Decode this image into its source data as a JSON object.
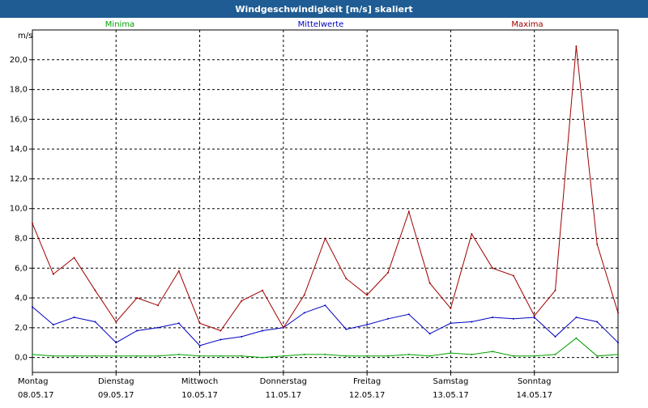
{
  "window": {
    "title": "Windgeschwindigkeit [m/s] skaliert"
  },
  "chart_data": {
    "type": "line",
    "title": "Windgeschwindigkeit [m/s] skaliert",
    "ylabel": "m/s",
    "xlabel": "",
    "ylim": [
      -1.0,
      22.0
    ],
    "xlim": [
      0,
      7
    ],
    "grid": true,
    "yticks": [
      0,
      2,
      4,
      6,
      8,
      10,
      12,
      14,
      16,
      18,
      20
    ],
    "ytick_labels": [
      "0,0",
      "2,0",
      "4,0",
      "6,0",
      "8,0",
      "10,0",
      "12,0",
      "14,0",
      "16,0",
      "18,0",
      "20,0"
    ],
    "x_ticks": [
      {
        "day": "Montag",
        "date": "08.05.17"
      },
      {
        "day": "Dienstag",
        "date": "09.05.17"
      },
      {
        "day": "Mittwoch",
        "date": "10.05.17"
      },
      {
        "day": "Donnerstag",
        "date": "11.05.17"
      },
      {
        "day": "Freitag",
        "date": "12.05.17"
      },
      {
        "day": "Samstag",
        "date": "13.05.17"
      },
      {
        "day": "Sonntag",
        "date": "14.05.17"
      }
    ],
    "x": [
      0.0,
      0.25,
      0.5,
      0.75,
      1.0,
      1.25,
      1.5,
      1.75,
      2.0,
      2.25,
      2.5,
      2.75,
      3.0,
      3.25,
      3.5,
      3.75,
      4.0,
      4.25,
      4.5,
      4.75,
      5.0,
      5.25,
      5.5,
      5.75,
      6.0,
      6.25,
      6.5,
      6.75,
      7.0
    ],
    "series": [
      {
        "name": "Minima",
        "color": "#00a000",
        "values": [
          0.2,
          0.1,
          0.1,
          0.1,
          0.1,
          0.1,
          0.1,
          0.2,
          0.1,
          0.1,
          0.1,
          0.0,
          0.1,
          0.2,
          0.2,
          0.1,
          0.1,
          0.1,
          0.2,
          0.1,
          0.3,
          0.2,
          0.4,
          0.1,
          0.1,
          0.2,
          1.3,
          0.1,
          0.2
        ]
      },
      {
        "name": "Mittelwerte",
        "color": "#0000c0",
        "values": [
          3.4,
          2.2,
          2.7,
          2.4,
          1.0,
          1.8,
          2.0,
          2.3,
          0.8,
          1.2,
          1.4,
          1.8,
          2.0,
          3.0,
          3.5,
          1.9,
          2.2,
          2.6,
          2.9,
          1.6,
          2.3,
          2.4,
          2.7,
          2.6,
          2.7,
          1.4,
          2.7,
          2.4,
          1.0
        ]
      },
      {
        "name": "Maxima",
        "color": "#a00000",
        "values": [
          9.0,
          5.6,
          6.7,
          4.5,
          2.4,
          4.0,
          3.5,
          5.8,
          2.3,
          1.8,
          3.8,
          4.5,
          2.0,
          4.2,
          8.0,
          5.3,
          4.2,
          5.7,
          9.8,
          5.0,
          3.3,
          8.3,
          6.0,
          5.5,
          2.8,
          4.5,
          20.9,
          7.6,
          3.0
        ]
      }
    ]
  }
}
